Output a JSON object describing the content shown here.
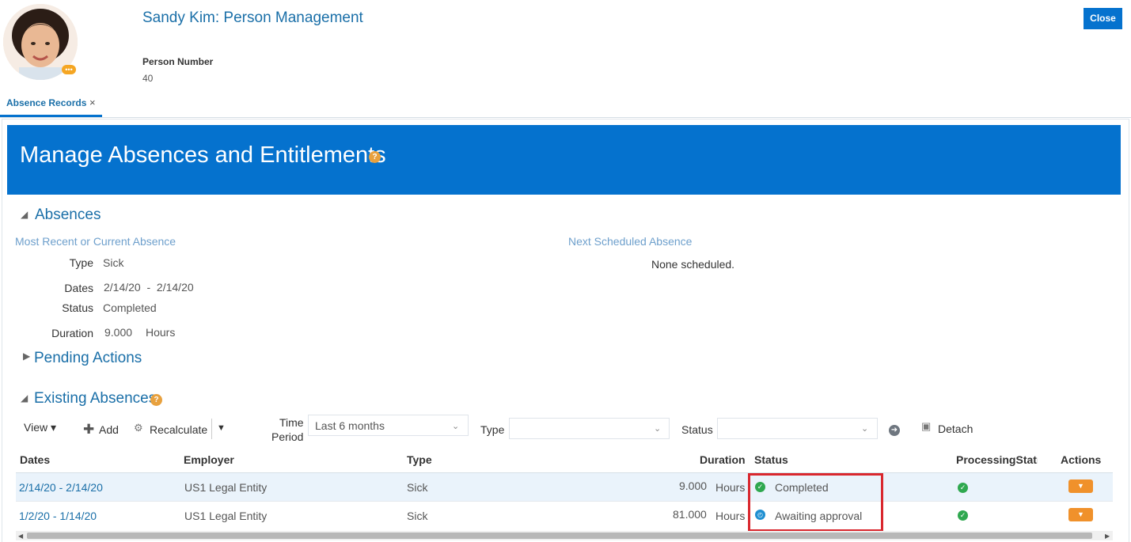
{
  "header": {
    "title": "Sandy Kim: Person Management",
    "person_number_label": "Person Number",
    "person_number": "40",
    "close_label": "Close",
    "avatar_badge": "•••"
  },
  "tab": {
    "label": "Absence Records",
    "close_glyph": "×"
  },
  "page": {
    "title": "Manage Absences and Entitlements",
    "help_glyph": "?"
  },
  "absences": {
    "heading": "Absences",
    "recent_heading": "Most Recent or Current Absence",
    "next_heading": "Next Scheduled Absence",
    "next_value": "None scheduled.",
    "fields": {
      "type_label": "Type",
      "type_value": "Sick",
      "dates_label": "Dates",
      "dates_value": "2/14/20  -  2/14/20",
      "status_label": "Status",
      "status_value": "Completed",
      "duration_label": "Duration",
      "duration_value": "9.000",
      "duration_unit": "Hours"
    }
  },
  "pending": {
    "heading": "Pending Actions"
  },
  "existing": {
    "heading": "Existing Absences",
    "toolbar": {
      "view_label": "View ▾",
      "add_label": "Add",
      "recalculate_label": "Recalculate",
      "time_period_label_1": "Time",
      "time_period_label_2": "Period",
      "time_period_value": "Last 6 months",
      "type_label": "Type",
      "type_value": "",
      "status_label": "Status",
      "status_value": "",
      "detach_label": "Detach"
    },
    "columns": [
      "Dates",
      "Employer",
      "Type",
      "Duration",
      "Status",
      "ProcessingStatı",
      "Actions"
    ],
    "rows": [
      {
        "dates": "2/14/20 - 2/14/20",
        "employer": "US1 Legal Entity",
        "type": "Sick",
        "duration": "9.000",
        "unit": "Hours",
        "status": "Completed"
      },
      {
        "dates": "1/2/20 - 1/14/20",
        "employer": "US1 Legal Entity",
        "type": "Sick",
        "duration": "81.000",
        "unit": "Hours",
        "status": "Awaiting approval"
      }
    ]
  },
  "colors": {
    "brand_blue": "#0572ce",
    "link_blue": "#1a6fa8",
    "accent_orange": "#f0912b",
    "highlight_red": "#d9272e"
  }
}
